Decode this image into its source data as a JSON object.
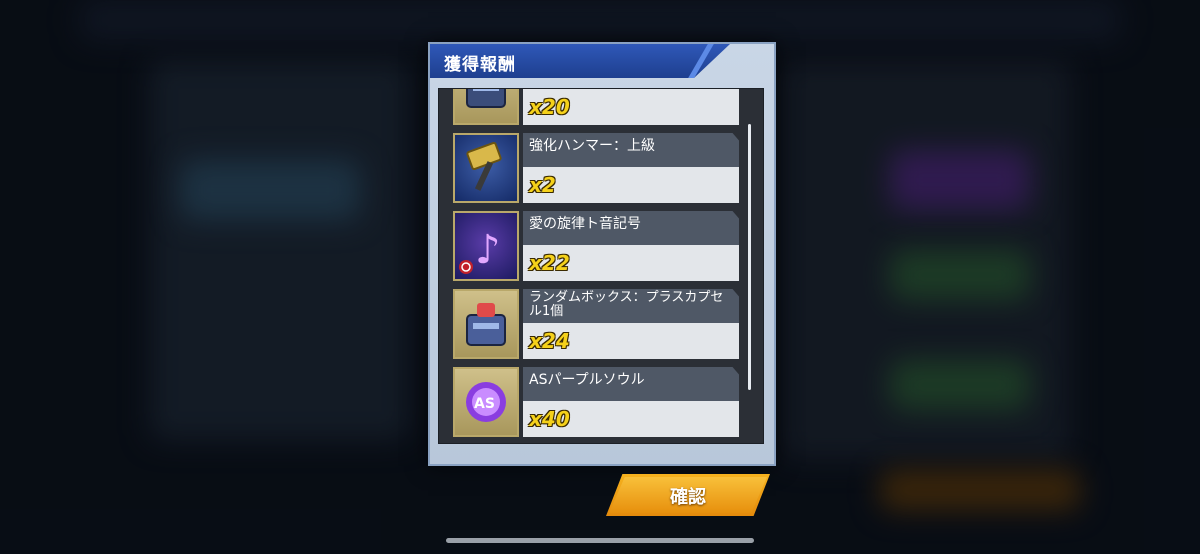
{
  "dialog": {
    "title": "獲得報酬",
    "items": [
      {
        "name": "",
        "quantity": "x20",
        "icon": "capsule-box-icon"
      },
      {
        "name": "強化ハンマー：上級",
        "quantity": "x2",
        "icon": "hammer-icon"
      },
      {
        "name": "愛の旋律ト音記号",
        "quantity": "x22",
        "icon": "treble-clef-icon"
      },
      {
        "name": "ランダムボックス：プラスカプセル1個",
        "quantity": "x24",
        "icon": "random-box-icon"
      },
      {
        "name": "ASパープルソウル",
        "quantity": "x40",
        "icon": "purple-soul-icon"
      }
    ],
    "confirm_label": "確認"
  },
  "colors": {
    "title_bar": "#2f58b8",
    "quantity_text": "#f5d11a",
    "confirm_button": "#f6b21e"
  }
}
